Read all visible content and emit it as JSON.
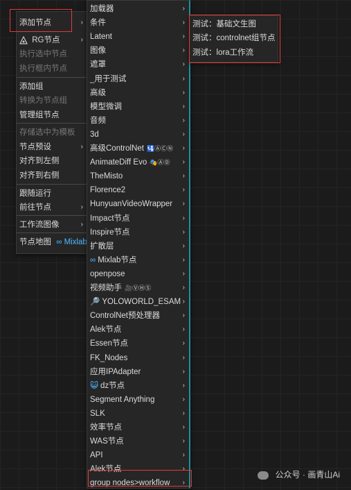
{
  "context_menu": {
    "items": [
      {
        "label": "添加节点",
        "arrow": "›",
        "disabled": false
      },
      {
        "label": "RG节点",
        "arrow": "›",
        "disabled": false
      },
      {
        "label": "执行选中节点",
        "disabled": true
      },
      {
        "label": "执行框内节点",
        "disabled": true
      },
      {
        "label": "添加组",
        "disabled": false
      },
      {
        "label": "转换为节点组",
        "disabled": true
      },
      {
        "label": "管理组节点",
        "disabled": false
      },
      {
        "label": "存储选中为模板",
        "disabled": true
      },
      {
        "label": "节点预设",
        "arrow": "›",
        "disabled": false
      },
      {
        "label": "对齐到左侧",
        "disabled": false
      },
      {
        "label": "对齐到右侧",
        "disabled": false
      },
      {
        "label": "跟随运行",
        "disabled": false
      },
      {
        "label": "前往节点",
        "arrow": "›",
        "disabled": false
      },
      {
        "label": "工作流图像",
        "arrow": "›",
        "disabled": false
      },
      {
        "label": "节点地图",
        "suffix": "∞ Mixlab",
        "disabled": false
      }
    ]
  },
  "submenu": {
    "items": [
      {
        "label": "加载器"
      },
      {
        "label": "条件"
      },
      {
        "label": "Latent"
      },
      {
        "label": "图像"
      },
      {
        "label": "遮罩"
      },
      {
        "label": "_用于测试"
      },
      {
        "label": "高级"
      },
      {
        "label": "模型微调"
      },
      {
        "label": "音频"
      },
      {
        "label": "3d"
      },
      {
        "label": "高级ControlNet",
        "badge": "🛂ⒶⒸⓃ"
      },
      {
        "label": "AnimateDiff Evo",
        "badge": "🎭ⒶⒹ"
      },
      {
        "label": "TheMisto"
      },
      {
        "label": "Florence2"
      },
      {
        "label": "HunyuanVideoWrapper"
      },
      {
        "label": "Impact节点"
      },
      {
        "label": "Inspire节点"
      },
      {
        "label": "扩散层"
      },
      {
        "label": "Mixlab节点",
        "prefix": "∞"
      },
      {
        "label": "openpose"
      },
      {
        "label": "视频助手",
        "badge": "🎥ⓋⒽⓈ"
      },
      {
        "label": "YOLOWORLD_ESAM",
        "prefix": "🔎"
      },
      {
        "label": "ControlNet预处理器"
      },
      {
        "label": "Alek节点"
      },
      {
        "label": "Essen节点"
      },
      {
        "label": "FK_Nodes"
      },
      {
        "label": "应用IPAdapter"
      },
      {
        "label": "dz节点",
        "prefix": "😺"
      },
      {
        "label": "Segment Anything"
      },
      {
        "label": "SLK"
      },
      {
        "label": "效率节点"
      },
      {
        "label": "WAS节点"
      },
      {
        "label": "API"
      },
      {
        "label": "Alek节点"
      },
      {
        "label": "group nodes>workflow"
      }
    ],
    "arrow": "›"
  },
  "workflow_menu": {
    "items": [
      {
        "label": "测试：基础文生图"
      },
      {
        "label": "测试：controlnet组节点"
      },
      {
        "label": "测试：lora工作流"
      }
    ]
  },
  "watermark": {
    "text": "公众号 · 画青山Ai"
  },
  "colors": {
    "highlight": "#e23b3b",
    "accent": "#1f8fa0"
  }
}
